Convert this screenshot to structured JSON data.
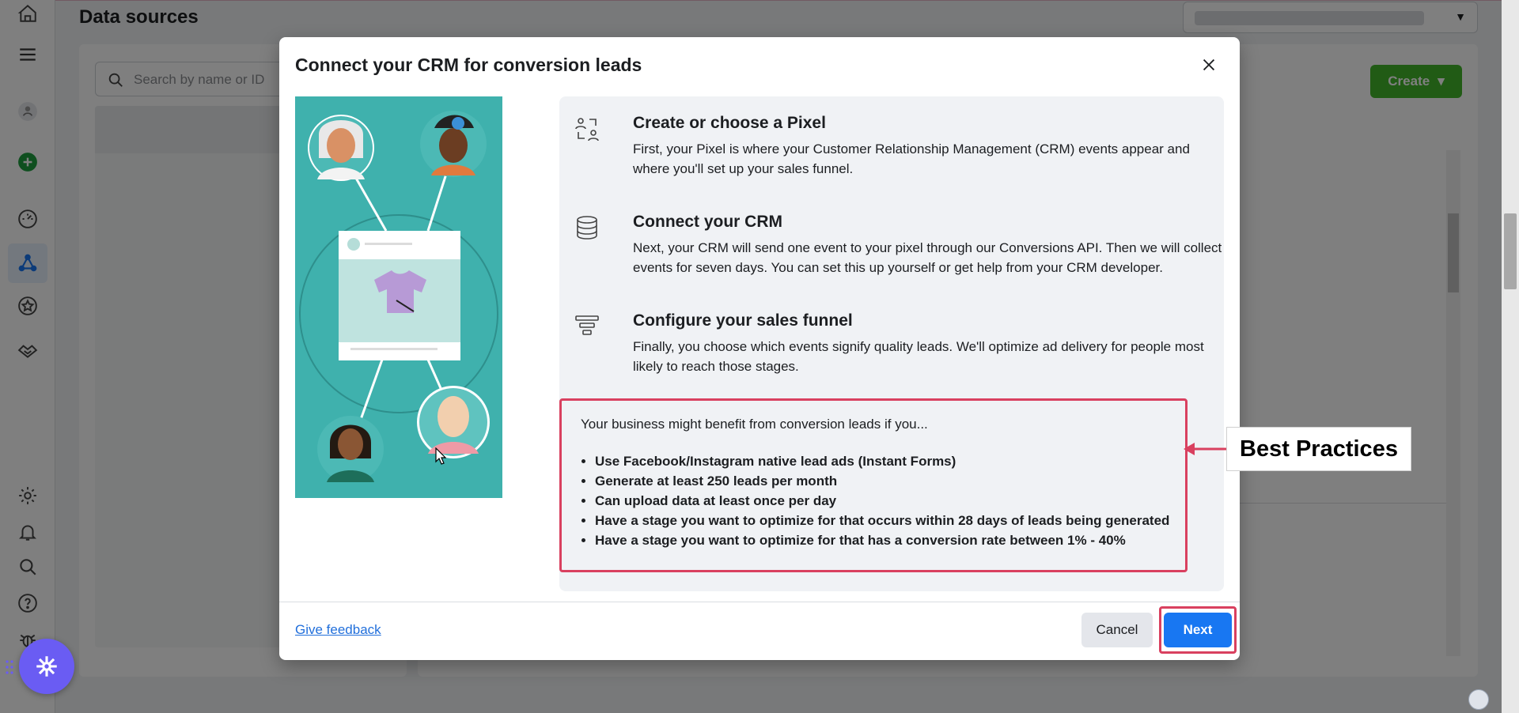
{
  "background": {
    "page_title": "Data sources",
    "search_placeholder": "Search by name or ID",
    "create_label": "Create"
  },
  "modal": {
    "title": "Connect your CRM for conversion leads",
    "steps": [
      {
        "icon": "pixel-people-icon",
        "title": "Create or choose a Pixel",
        "description": "First, your Pixel is where your Customer Relationship Management (CRM) events appear and where you'll set up your sales funnel."
      },
      {
        "icon": "database-icon",
        "title": "Connect your CRM",
        "description": "Next, your CRM will send one event to your pixel through our Conversions API. Then we will collect events for seven days. You can set this up yourself or get help from your CRM developer."
      },
      {
        "icon": "funnel-icon",
        "title": "Configure your sales funnel",
        "description": "Finally, you choose which events signify quality leads. We'll optimize ad delivery for people most likely to reach those stages."
      }
    ],
    "benefits": {
      "intro": "Your business might benefit from conversion leads if you...",
      "items": [
        "Use Facebook/Instagram native lead ads (Instant Forms)",
        "Generate at least 250 leads per month",
        "Can upload data at least once per day",
        "Have a stage you want to optimize for that occurs within 28 days of leads being generated",
        "Have a stage you want to optimize for that has a conversion rate between 1% - 40%"
      ]
    },
    "footer": {
      "feedback_label": "Give feedback",
      "cancel_label": "Cancel",
      "next_label": "Next"
    }
  },
  "annotation": {
    "label": "Best Practices",
    "highlight_color": "#d9405f"
  },
  "colors": {
    "primary": "#1877f2",
    "create_green": "#42b72a",
    "illustration_teal": "#3fb1ad",
    "link": "#216fdb"
  }
}
